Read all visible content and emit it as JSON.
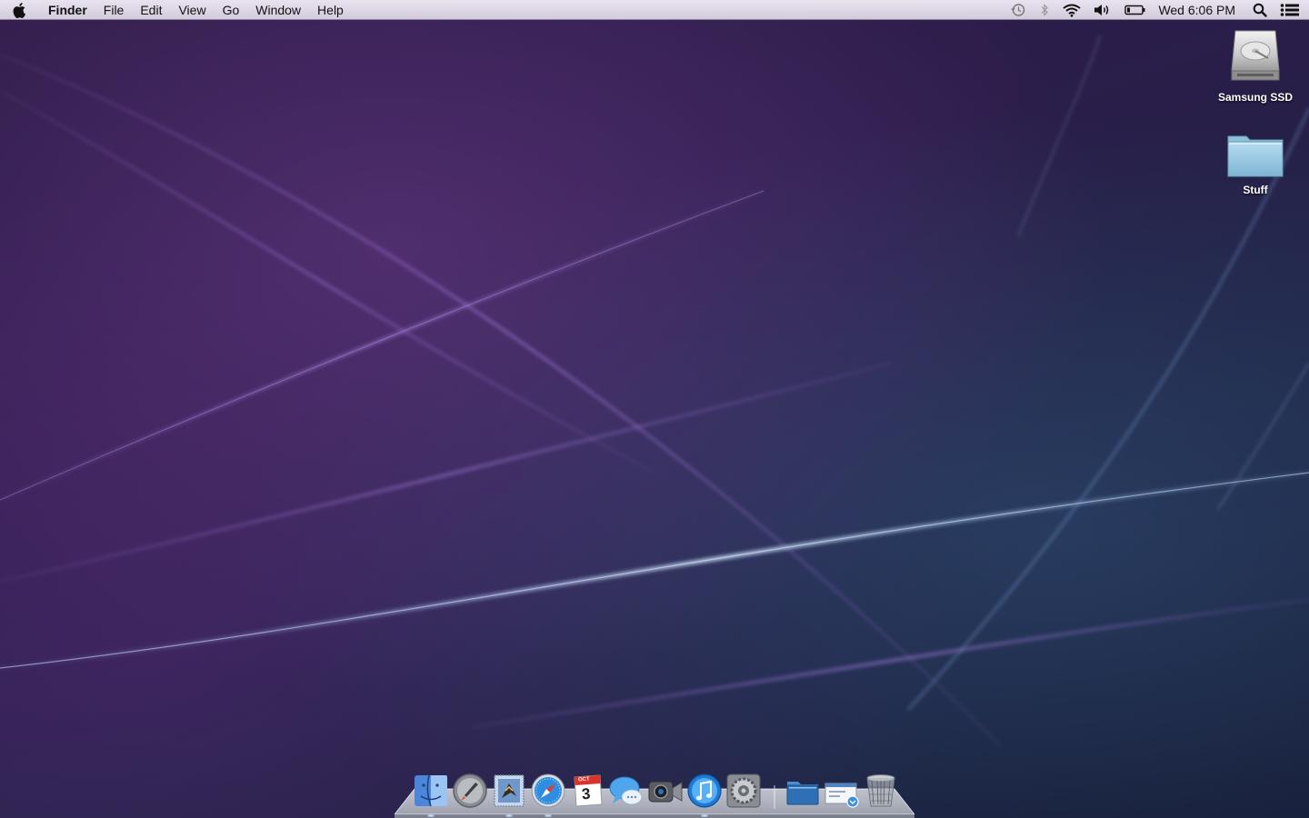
{
  "menubar": {
    "apple_icon": "apple-logo-icon",
    "app_name": "Finder",
    "menus": [
      "File",
      "Edit",
      "View",
      "Go",
      "Window",
      "Help"
    ],
    "status_icons": [
      "time-machine-icon",
      "bluetooth-icon",
      "wifi-icon",
      "volume-icon",
      "battery-icon"
    ],
    "clock": "Wed 6:06 PM",
    "spotlight_icon": "spotlight-search-icon",
    "notification_icon": "notification-center-icon"
  },
  "desktop": {
    "icons": [
      {
        "label": "Samsung SSD",
        "icon": "hard-drive-icon"
      },
      {
        "label": "Stuff",
        "icon": "folder-icon"
      }
    ]
  },
  "dock": {
    "apps": [
      {
        "icon": "finder-icon",
        "running": true
      },
      {
        "icon": "launchpad-icon",
        "running": false
      },
      {
        "icon": "mail-icon",
        "running": true
      },
      {
        "icon": "safari-icon",
        "running": true
      },
      {
        "icon": "calendar-icon",
        "running": false,
        "calendar_month": "OCT",
        "calendar_day": "3"
      },
      {
        "icon": "messages-icon",
        "running": false
      },
      {
        "icon": "facetime-icon",
        "running": false
      },
      {
        "icon": "itunes-icon",
        "running": true
      },
      {
        "icon": "system-preferences-icon",
        "running": false
      }
    ],
    "stacks": [
      {
        "icon": "documents-folder-icon"
      },
      {
        "icon": "downloads-stack-icon"
      },
      {
        "icon": "trash-icon"
      }
    ]
  },
  "colors": {
    "menubar_top": "#e9e3f0",
    "menubar_bottom": "#d3cbdc",
    "desktop_purple": "#2b1d4a",
    "desktop_blue": "#1e2444"
  }
}
